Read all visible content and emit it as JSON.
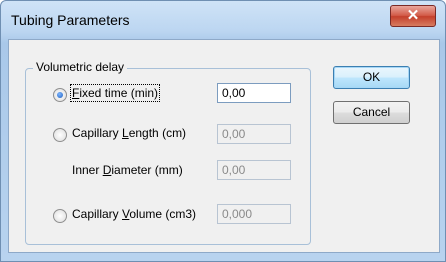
{
  "window": {
    "title": "Tubing Parameters"
  },
  "close_glyph": "✕",
  "group": {
    "legend": "Volumetric delay"
  },
  "options": {
    "fixed_time": {
      "pre": "",
      "underline": "F",
      "post": "ixed time (min)",
      "value": "0,00",
      "checked": true,
      "enabled": true
    },
    "capillary_length": {
      "pre": "Capillary ",
      "underline": "L",
      "post": "ength (cm)",
      "value": "0,00",
      "enabled": false
    },
    "inner_diameter": {
      "pre": "Inner ",
      "underline": "D",
      "post": "iameter (mm)",
      "value": "0,00",
      "enabled": false
    },
    "capillary_volume": {
      "pre": "Capillary ",
      "underline": "V",
      "post": "olume (cm3)",
      "value": "0,000",
      "enabled": false
    }
  },
  "buttons": {
    "ok": "OK",
    "cancel": "Cancel"
  }
}
